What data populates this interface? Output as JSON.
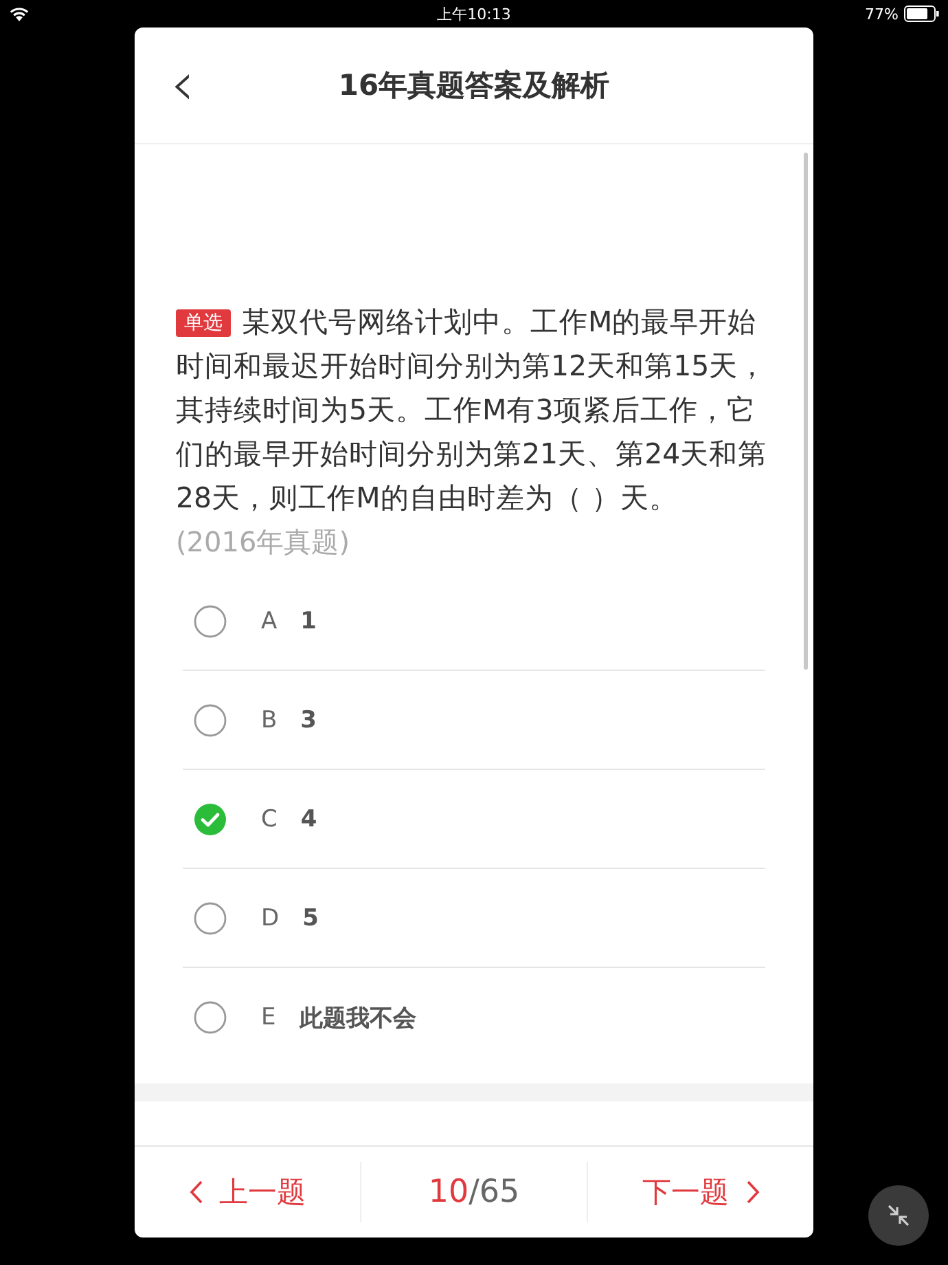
{
  "status_bar": {
    "time": "上午10:13",
    "battery": "77%"
  },
  "header": {
    "back": "‹",
    "title": "16年真题答案及解析"
  },
  "question": {
    "tag": "单选",
    "text": "某双代号网络计划中。工作M的最早开始时间和最迟开始时间分别为第12天和第15天，其持续时间为5天。工作M有3项紧后工作，它们的最早开始时间分别为第21天、第24天和第28天，则工作M的自由时差为（  ）天。",
    "source": "(2016年真题)"
  },
  "options": [
    {
      "letter": "A",
      "text": "1",
      "selected": false
    },
    {
      "letter": "B",
      "text": "3",
      "selected": false
    },
    {
      "letter": "C",
      "text": "4",
      "selected": true
    },
    {
      "letter": "D",
      "text": "5",
      "selected": false
    },
    {
      "letter": "E",
      "text": "此题我不会",
      "selected": false
    }
  ],
  "footer": {
    "prev": "上一题",
    "current": "10",
    "total": "/65",
    "next": "下一题"
  }
}
